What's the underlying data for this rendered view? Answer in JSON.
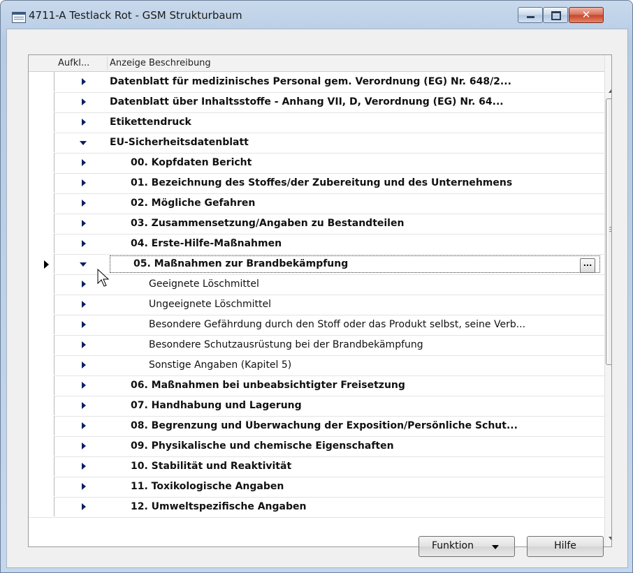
{
  "window": {
    "title": "4711-A Testlack Rot - GSM Strukturbaum",
    "close_glyph": "✕"
  },
  "columns": {
    "expand": "Aufkl...",
    "description": "Anzeige Beschreibung"
  },
  "rows": [
    {
      "label": "Datenblatt für medizinisches Personal gem. Verordnung (EG) Nr. 648/2...",
      "level": 0,
      "bold": true,
      "state": "collapsed"
    },
    {
      "label": "Datenblatt über Inhaltsstoffe  -  Anhang VII, D, Verordnung (EG) Nr. 64...",
      "level": 0,
      "bold": true,
      "state": "collapsed"
    },
    {
      "label": "Etikettendruck",
      "level": 0,
      "bold": true,
      "state": "collapsed"
    },
    {
      "label": "EU-Sicherheitsdatenblatt",
      "level": 0,
      "bold": true,
      "state": "expanded"
    },
    {
      "label": "00. Kopfdaten Bericht",
      "level": 1,
      "bold": true,
      "state": "collapsed"
    },
    {
      "label": "01. Bezeichnung des Stoffes/der Zubereitung und des Unternehmens",
      "level": 1,
      "bold": true,
      "state": "collapsed"
    },
    {
      "label": "02. Mögliche Gefahren",
      "level": 1,
      "bold": true,
      "state": "collapsed"
    },
    {
      "label": "03. Zusammensetzung/Angaben zu Bestandteilen",
      "level": 1,
      "bold": true,
      "state": "collapsed"
    },
    {
      "label": "04. Erste-Hilfe-Maßnahmen",
      "level": 1,
      "bold": true,
      "state": "collapsed"
    },
    {
      "label": "05. Maßnahmen zur Brandbekämpfung",
      "level": 1,
      "bold": true,
      "state": "expanded",
      "selected": true,
      "ellipsis": "..."
    },
    {
      "label": "Geeignete Löschmittel",
      "level": 2,
      "bold": false,
      "state": "collapsed"
    },
    {
      "label": "Ungeeignete Löschmittel",
      "level": 2,
      "bold": false,
      "state": "collapsed"
    },
    {
      "label": "Besondere Gefährdung durch den Stoff oder das Produkt selbst, seine Verb...",
      "level": 2,
      "bold": false,
      "state": "collapsed"
    },
    {
      "label": "Besondere Schutzausrüstung bei der Brandbekämpfung",
      "level": 2,
      "bold": false,
      "state": "collapsed"
    },
    {
      "label": "Sonstige Angaben (Kapitel 5)",
      "level": 2,
      "bold": false,
      "state": "collapsed"
    },
    {
      "label": "06. Maßnahmen bei unbeabsichtigter Freisetzung",
      "level": 1,
      "bold": true,
      "state": "collapsed"
    },
    {
      "label": "07. Handhabung und Lagerung",
      "level": 1,
      "bold": true,
      "state": "collapsed"
    },
    {
      "label": "08. Begrenzung und Überwachung der Exposition/Persönliche Schut...",
      "level": 1,
      "bold": true,
      "state": "collapsed"
    },
    {
      "label": "09. Physikalische und chemische Eigenschaften",
      "level": 1,
      "bold": true,
      "state": "collapsed"
    },
    {
      "label": "10. Stabilität und Reaktivität",
      "level": 1,
      "bold": true,
      "state": "collapsed"
    },
    {
      "label": "11. Toxikologische Angaben",
      "level": 1,
      "bold": true,
      "state": "collapsed"
    },
    {
      "label": "12. Umweltspezifische Angaben",
      "level": 1,
      "bold": true,
      "state": "collapsed"
    }
  ],
  "buttons": {
    "funktion": "Funktion",
    "hilfe": "Hilfe"
  },
  "colors": {
    "expander": "#0a1f66",
    "window_frame": "#b5cbe4"
  }
}
